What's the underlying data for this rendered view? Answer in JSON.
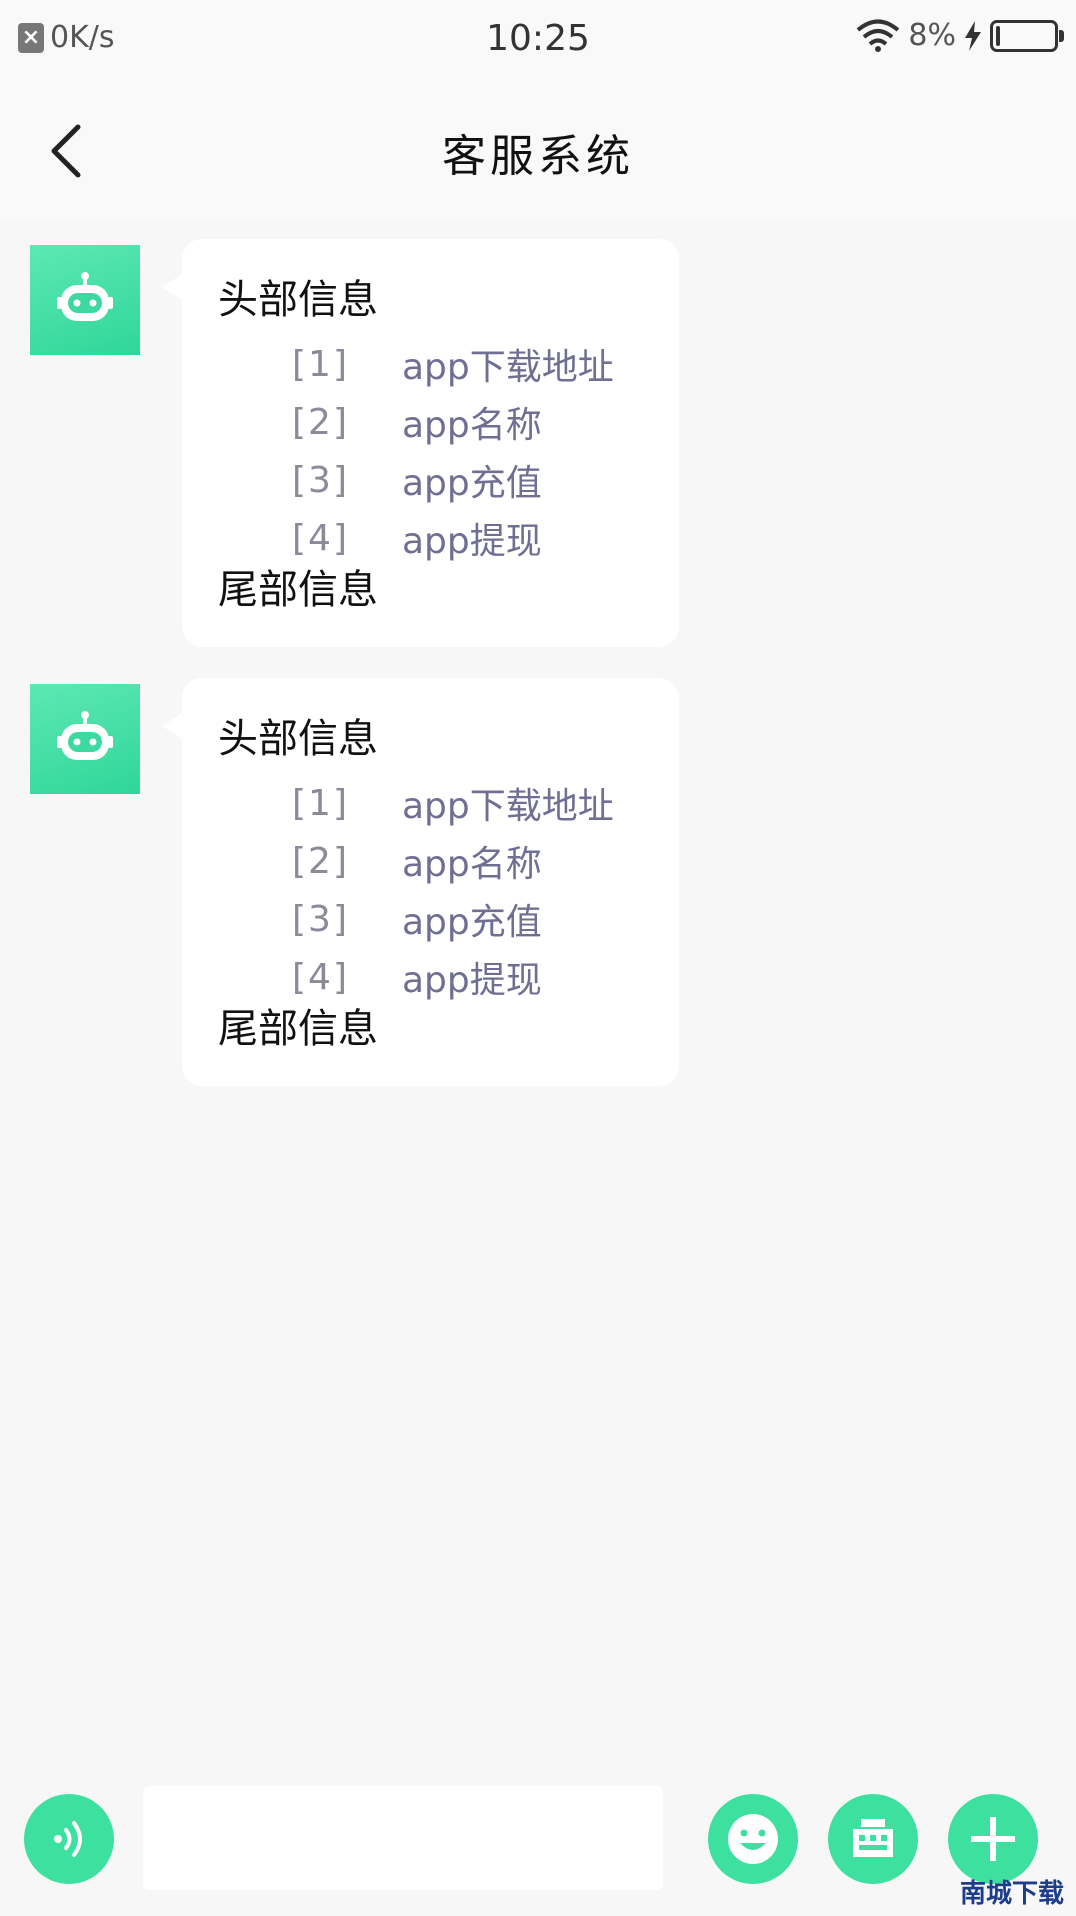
{
  "status_bar": {
    "net_speed": "0K/s",
    "time": "10:25",
    "battery_percent": "8%",
    "battery_level": 0.08
  },
  "header": {
    "title": "客服系统"
  },
  "messages": [
    {
      "header": "头部信息",
      "items": [
        {
          "num": "[1]",
          "label": "app下载地址"
        },
        {
          "num": "[2]",
          "label": "app名称"
        },
        {
          "num": "[3]",
          "label": "app充值"
        },
        {
          "num": "[4]",
          "label": "app提现"
        }
      ],
      "footer": "尾部信息"
    },
    {
      "header": "头部信息",
      "items": [
        {
          "num": "[1]",
          "label": "app下载地址"
        },
        {
          "num": "[2]",
          "label": "app名称"
        },
        {
          "num": "[3]",
          "label": "app充值"
        },
        {
          "num": "[4]",
          "label": "app提现"
        }
      ],
      "footer": "尾部信息"
    }
  ],
  "input": {
    "value": "",
    "placeholder": ""
  },
  "icons": {
    "voice": "voice-wave-icon",
    "emoji": "smiley-icon",
    "keyboard": "keyboard-icon",
    "plus": "plus-icon",
    "avatar": "robot-icon"
  },
  "colors": {
    "accent": "#3ee09f",
    "bubble": "#ffffff",
    "background": "#f7f7f7"
  },
  "watermark": "南城下载"
}
